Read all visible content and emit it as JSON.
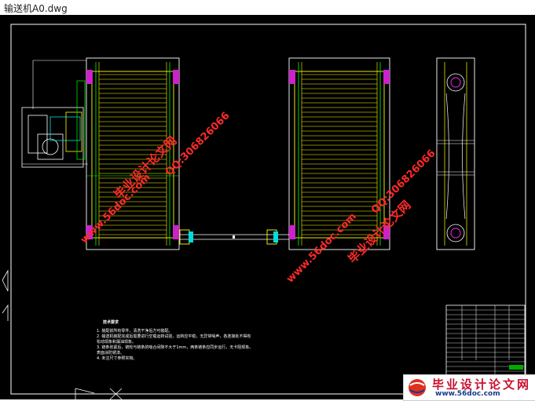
{
  "window": {
    "title": "输送机A0.dwg"
  },
  "watermarks": {
    "site_name": "毕业设计论文网",
    "url": "www.56doc.com",
    "qq": "QQ:306826066"
  },
  "tech_notes": {
    "title": "技术要求",
    "lines": [
      "1. 装配前所有零件，清洗干净后方可装配。",
      "2. 输送机装配完成后需要进行空载运转试验，运转应平稳，无异常噪声，各连接处不得有",
      "   松动现象和漏油现象。",
      "3. 链条张紧后，链轮与链条的啮合间隙不大于1mm，两条链条应同步运行，无卡阻现象。",
      "   表面涂防锈漆。",
      "4. 未注尺寸参照实物。"
    ]
  },
  "logo": {
    "name": "毕业设计论文网",
    "url": "www.56doc.com"
  }
}
